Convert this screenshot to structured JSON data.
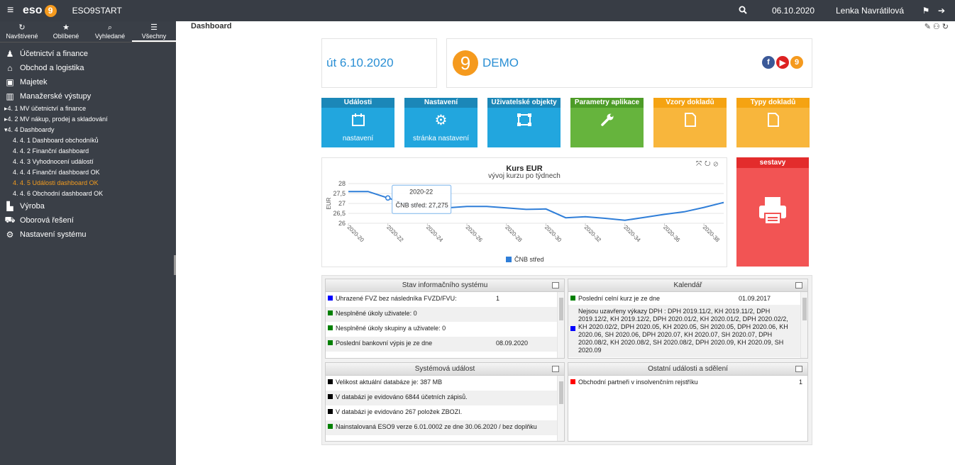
{
  "topbar": {
    "logo_text": "eso",
    "logo_nine": "9",
    "app_name": "ESO9START",
    "date": "06.10.2020",
    "user": "Lenka Navrátilová"
  },
  "sidebar": {
    "tabs": [
      {
        "label": "Navštívené",
        "icon": "history-icon"
      },
      {
        "label": "Oblíbené",
        "icon": "star-icon"
      },
      {
        "label": "Vyhledané",
        "icon": "search-icon"
      },
      {
        "label": "Všechny",
        "icon": "list-icon"
      }
    ],
    "menu": {
      "ucetnictvi": "Účetnictví a finance",
      "obchod": "Obchod a logistika",
      "majetek": "Majetek",
      "manazerske": "Manažerské výstupy",
      "mv1": "▸4. 1  MV účetnictví a finance",
      "mv2": "▸4. 2  MV nákup, prodej a skladování",
      "mv4": "▾4. 4  Dashboardy",
      "d1": "4. 4. 1  Dashboard obchodníků",
      "d2": "4. 4. 2  Finanční dashboard",
      "d3": "4. 4. 3  Vyhodnocení událostí",
      "d4": "4. 4. 4  Finanční dashboard OK",
      "d5": "4. 4. 5  Události dashboard OK",
      "d6": "4. 4. 6  Obchodní dashboard OK",
      "vyroba": "Výroba",
      "oborova": "Oborová řešení",
      "nastaveni": "Nastavení systému"
    }
  },
  "main": {
    "breadcrumb": "Dashboard",
    "date_box": "út 6.10.2020",
    "demo_nine": "9",
    "demo_label": "DEMO",
    "social": {
      "facebook": "f",
      "youtube": "▶",
      "eso": "9"
    },
    "tiles": [
      {
        "title": "Události",
        "footer": "nastavení",
        "icon": "calendar-icon",
        "color": "#22a6de",
        "header": "#1b87b8"
      },
      {
        "title": "Nastavení",
        "footer": "stránka nastavení",
        "icon": "gears-icon",
        "color": "#22a6de",
        "header": "#1b87b8"
      },
      {
        "title": "Uživatelské objekty",
        "footer": "",
        "icon": "objects-icon",
        "color": "#22a6de",
        "header": "#1b87b8"
      },
      {
        "title": "Parametry aplikace",
        "footer": "",
        "icon": "wrench-icon",
        "color": "#66b43d",
        "header": "#4d9c27"
      },
      {
        "title": "Vzory dokladů",
        "footer": "",
        "icon": "document-icon",
        "color": "#f8b63c",
        "header": "#f5a312"
      },
      {
        "title": "Typy dokladů",
        "footer": "",
        "icon": "document-icon",
        "color": "#f8b63c",
        "header": "#f5a312"
      }
    ],
    "sestavy": {
      "title": "sestavy",
      "icon": "printer-icon"
    },
    "panels": {
      "stav": {
        "title": "Stav informačního systému",
        "rows": [
          {
            "color": "#0000ff",
            "text": "Uhrazené FVZ bez následníka FVZD/FVU:",
            "value": "1"
          },
          {
            "color": "#008000",
            "text": "Nesplněné úkoly uživatele: 0",
            "value": ""
          },
          {
            "color": "#008000",
            "text": "Nesplněné úkoly skupiny a uživatele: 0",
            "value": ""
          },
          {
            "color": "#008000",
            "text": "Poslední bankovní výpis je ze dne",
            "value": "08.09.2020"
          }
        ]
      },
      "kalendar": {
        "title": "Kalendář",
        "rows": [
          {
            "color": "#008000",
            "text": "Poslední celní kurz je ze dne",
            "value": "01.09.2017"
          },
          {
            "color": "#0000ff",
            "text": "Nejsou uzavřeny výkazy DPH : DPH 2019.11/2, KH 2019.11/2, DPH 2019.12/2, KH 2019.12/2, DPH 2020.01/2, KH 2020.01/2, DPH 2020.02/2, KH 2020.02/2, DPH 2020.05, KH 2020.05, SH 2020.05, DPH 2020.06, KH 2020.06, SH 2020.06, DPH 2020.07, KH 2020.07, SH 2020.07, DPH 2020.08/2, KH 2020.08/2, SH 2020.08/2, DPH 2020.09, KH 2020.09, SH 2020.09",
            "value": ""
          }
        ]
      },
      "system": {
        "title": "Systémová událost",
        "rows": [
          {
            "color": "#000000",
            "text": "Velikost aktuální databáze je: 387 MB",
            "value": ""
          },
          {
            "color": "#000000",
            "text": "V databázi je evidováno 6844 účetních zápisů.",
            "value": ""
          },
          {
            "color": "#000000",
            "text": "V databázi je evidováno 267 položek ZBOZI.",
            "value": ""
          },
          {
            "color": "#008000",
            "text": "Nainstalovaná ESO9 verze 6.01.0002 ze dne 30.06.2020 / bez doplňku",
            "value": ""
          }
        ]
      },
      "ostatni": {
        "title": "Ostatní události a sdělení",
        "rows": [
          {
            "color": "#ff0000",
            "text": "Obchodní partneři v insolvenčním rejstříku",
            "value": "1"
          }
        ]
      }
    }
  },
  "chart_data": {
    "type": "line",
    "title": "Kurs EUR",
    "subtitle": "vývoj kurzu po týdnech",
    "ylabel": "EUR",
    "xlabel": "",
    "ylim": [
      26,
      28
    ],
    "yticks": [
      "26",
      "26,5",
      "27",
      "27,5",
      "28"
    ],
    "x_tick_labels": [
      "2020-20",
      "2020-22",
      "2020-24",
      "2020-26",
      "2020-28",
      "2020-30",
      "2020-32",
      "2020-34",
      "2020-36",
      "2020-38"
    ],
    "x": [
      20,
      21,
      22,
      23,
      24,
      25,
      26,
      27,
      28,
      29,
      30,
      31,
      32,
      33,
      34,
      35,
      36,
      37,
      38,
      39
    ],
    "series": [
      {
        "name": "ČNB střed",
        "color": "#2f7ed8",
        "values": [
          27.6,
          27.6,
          27.275,
          26.95,
          26.8,
          26.78,
          26.85,
          26.85,
          26.78,
          26.7,
          26.72,
          26.28,
          26.33,
          26.25,
          26.15,
          26.3,
          26.45,
          26.58,
          26.8,
          27.05
        ]
      }
    ],
    "tooltip": {
      "x_label": "2020-22",
      "series": "ČNB střed",
      "value": "27,275"
    },
    "legend": "bottom",
    "grid": true
  }
}
